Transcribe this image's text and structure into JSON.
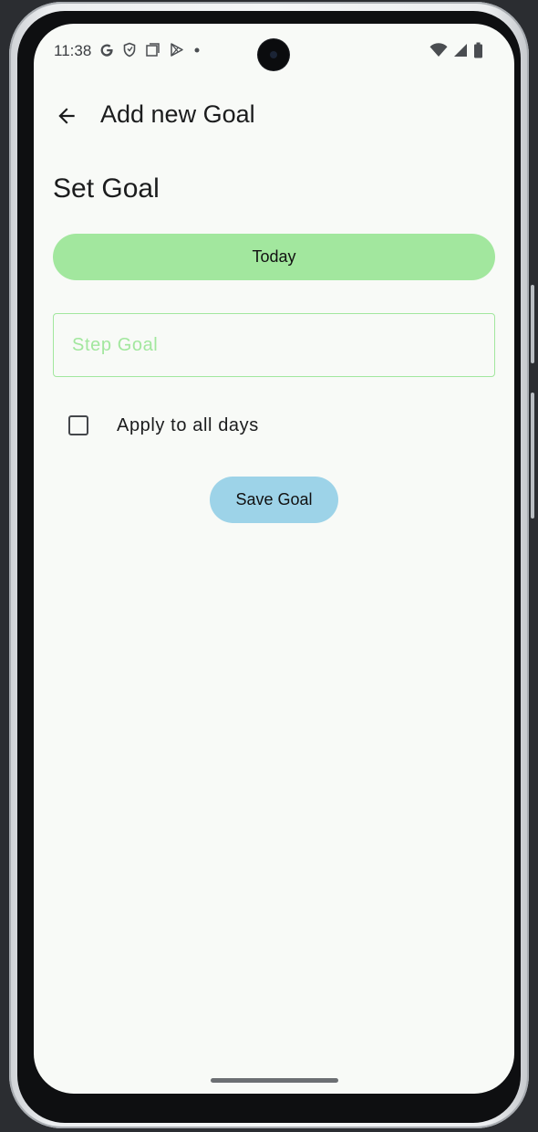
{
  "status_bar": {
    "time": "11:38",
    "left_icons": [
      "google-g-icon",
      "shield-icon",
      "square-icon",
      "play-store-icon",
      "dot-icon"
    ],
    "right_icons": [
      "wifi-icon",
      "signal-icon",
      "battery-icon"
    ]
  },
  "app_bar": {
    "title": "Add new Goal",
    "back_icon": "arrow-back-icon"
  },
  "form": {
    "section_title": "Set Goal",
    "date_button_label": "Today",
    "step_goal_placeholder": "Step Goal",
    "step_goal_value": "",
    "apply_all_label": "Apply to all days",
    "apply_all_checked": false,
    "save_button_label": "Save Goal"
  },
  "colors": {
    "date_button": "#a2e79e",
    "save_button": "#9dd3e8",
    "field_accent": "#a2e79e",
    "screen_background": "#f8faf7"
  }
}
